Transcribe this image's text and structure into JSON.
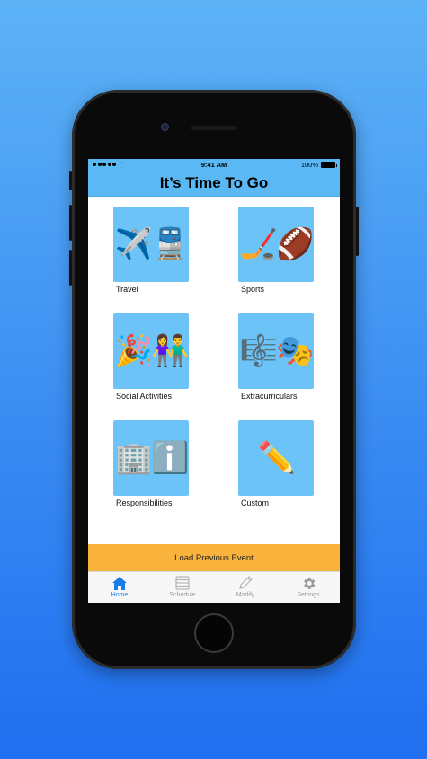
{
  "status_bar": {
    "time": "9:41 AM",
    "battery": "100%"
  },
  "header": {
    "title": "It’s Time To Go"
  },
  "categories": [
    {
      "label": "Travel",
      "emoji": "✈️🚆",
      "icon": "airplane-train-icon"
    },
    {
      "label": "Sports",
      "emoji": "🏒🏈",
      "icon": "hockey-football-icon"
    },
    {
      "label": "Social Activities",
      "emoji": "🎉👫",
      "icon": "party-couple-icon"
    },
    {
      "label": "Extracurriculars",
      "emoji": "🎼🎭",
      "icon": "music-theater-icon"
    },
    {
      "label": "Responsibilities",
      "emoji": "🏢ℹ️",
      "icon": "building-info-icon"
    },
    {
      "label": "Custom",
      "emoji": "✏️",
      "icon": "pencil-icon"
    }
  ],
  "load_button": {
    "label": "Load Previous Event"
  },
  "tabs": [
    {
      "label": "Home",
      "icon": "home-icon"
    },
    {
      "label": "Schedule",
      "icon": "schedule-icon"
    },
    {
      "label": "Modify",
      "icon": "pencil-icon"
    },
    {
      "label": "Settings",
      "icon": "gear-icon"
    }
  ],
  "colors": {
    "accent": "#5ab9f5",
    "tile": "#6cc3f7",
    "load_button": "#f9b23b",
    "active_tab": "#1a7ce8"
  }
}
